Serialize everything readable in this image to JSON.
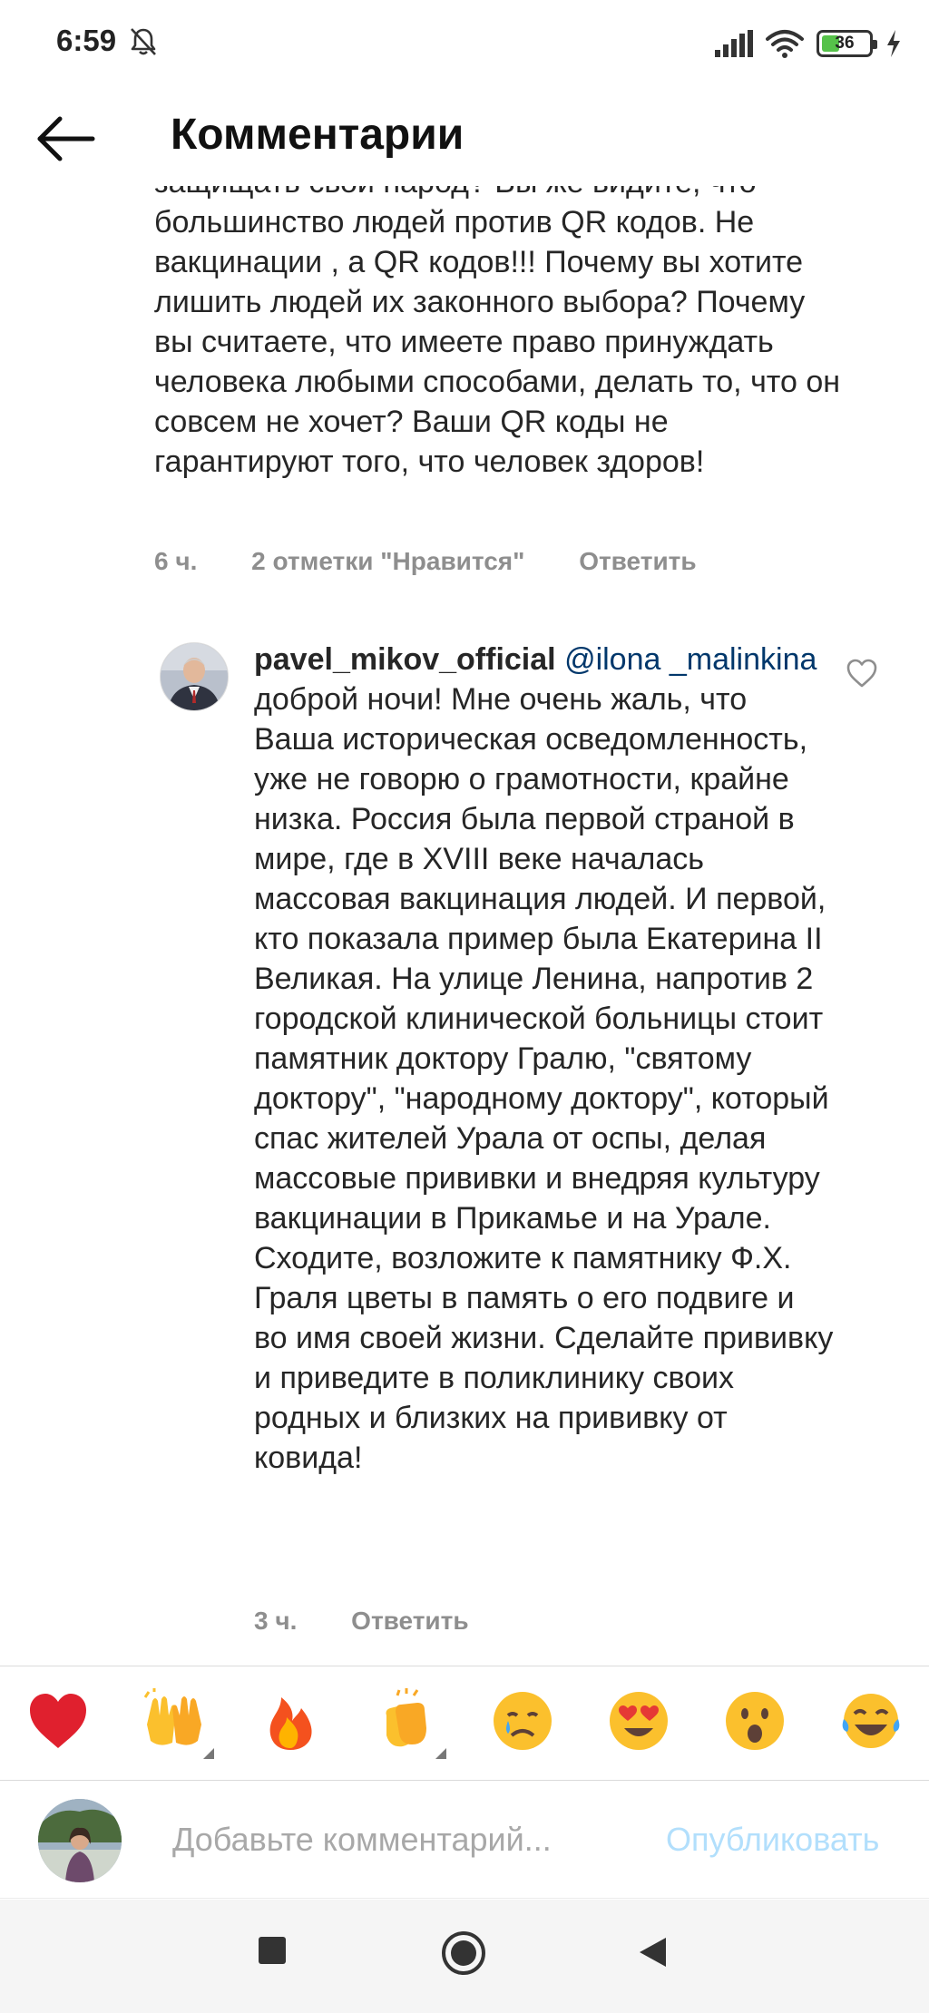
{
  "status_bar": {
    "time": "6:59",
    "battery": "36",
    "battery_level": 0.36,
    "icons": [
      "bell-off-icon",
      "signal-icon",
      "wifi-icon",
      "battery-icon",
      "charging-icon"
    ]
  },
  "header": {
    "title": "Комментарии",
    "back_icon": "arrow-left-icon"
  },
  "comment": {
    "text": "защищать свой народ? Вы же видите, что большинство людей против QR кодов. Не вакцинации , а QR кодов!!! Почему вы хотите лишить людей их законного выбора? Почему вы считаете, что имеете право принуждать человека любыми способами, делать то, что он совсем не хочет? Ваши QR коды не гарантируют того, что человек здоров!",
    "time": "6 ч.",
    "likes": "2 отметки \"Нравится\"",
    "reply_label": "Ответить"
  },
  "reply": {
    "username": "pavel_mikov_official",
    "mention": "@ilona _malinkina",
    "text": "доброй ночи! Мне очень жаль, что Ваша историческая осведомленность, уже не говорю о грамотности, крайне низка. Россия была первой страной в мире, где в XVIII веке началась массовая вакцинация людей. И первой, кто показала пример была Екатерина II Великая. На улице Ленина, напротив 2 городской клинической больницы стоит памятник доктору Гралю, \"святому доктору\", \"народному доктору\", который спас жителей Урала от оспы, делая массовые прививки и внедряя культуру вакцинации в Прикамье и на Урале. Сходите, возложите к памятнику Ф.Х. Граля цветы в память о его подвиге и во имя своей жизни. Сделайте прививку и приведите в поликлинику своих родных и близких на прививку от ковида!",
    "time": "3 ч.",
    "reply_label": "Ответить"
  },
  "emoji_bar": [
    "red-heart",
    "raising-hands",
    "fire",
    "clapping-hands",
    "crying-face",
    "heart-eyes-face",
    "astonished-face",
    "tears-of-joy-face"
  ],
  "input_bar": {
    "placeholder": "Добавьте комментарий...",
    "publish_label": "Опубликовать"
  },
  "colors": {
    "mention": "#00376b",
    "meta": "#8e8e8e",
    "publish_disabled": "#b2dffc",
    "battery_fill": "#56c24a"
  }
}
